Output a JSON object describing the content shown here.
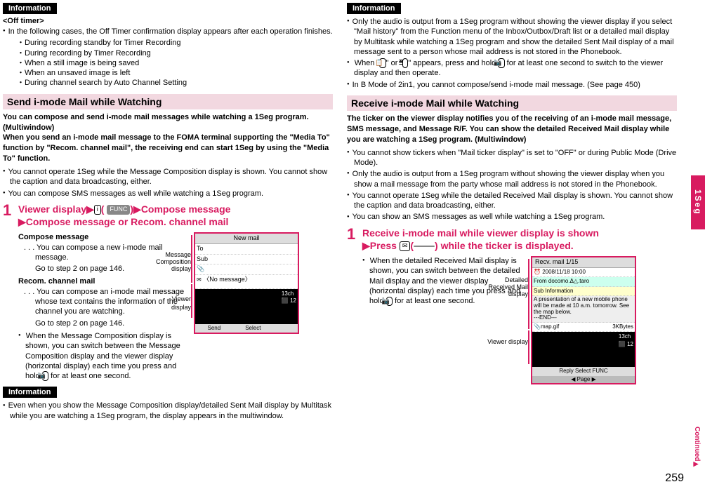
{
  "info_label": "Information",
  "col1": {
    "off_timer_hdr": "<Off timer>",
    "off_timer_intro": "In the following cases, the Off Timer confirmation display appears after each operation finishes.",
    "off_timer_items": [
      "・During recording standby for Timer Recording",
      "・During recording by Timer Recording",
      "・When a still image is being saved",
      "・When an unsaved image is left",
      "・During channel search by Auto Channel Setting"
    ],
    "section_send": "Send i-mode Mail while Watching",
    "send_bold": "You can compose and send i-mode mail messages while watching a 1Seg program. (Multiwindow)\nWhen you send an i-mode mail message to the FOMA terminal supporting the \"Media To\" function by \"Recom. channel mail\", the receiving end can start 1Seg by using the \"Media To\" function.",
    "send_b1": "You cannot operate 1Seg while the Message Composition display is shown. You cannot show the caption and data broadcasting, either.",
    "send_b2": "You can compose SMS messages as well while watching a 1Seg program.",
    "step1_num": "1",
    "step1a": "Viewer display",
    "step1_btn1": "i",
    "step1_func": "FUNC",
    "step1b": "Compose message",
    "step1c": "Compose message or Recom. channel mail",
    "compose_hdr": "Compose message",
    "compose_1": "You can compose a new i-mode mail message.",
    "compose_2": "Go to step 2 on page 146.",
    "recom_hdr": "Recom. channel mail",
    "recom_1": "You can compose an i-mode mail message whose text contains the information of the channel you are watching.",
    "recom_2": "Go to step 2 on page 146.",
    "compose_b3": "When the Message Composition display is shown, you can switch between the Message Composition display and the viewer display (horizontal display) each time you press and hold",
    "compose_b3_tail": "for at least one second.",
    "callout_msg": "Message Composition display",
    "callout_viewer": "Viewer display",
    "shot_title": "New mail",
    "shot_sub": "〈No message〉",
    "info2_text": "Even when you show the Message Composition display/detailed Sent Mail display by Multitask while you are watching a 1Seg program, the display appears in the multiwindow."
  },
  "col2": {
    "info1_b1": "Only the audio is output from a 1Seg program without showing the viewer display if you select \"Mail history\" from the Function menu of the Inbox/Outbox/Draft list or a detailed mail display by Multitask while watching a 1Seg program and show the detailed Sent Mail display of a mail message sent to a person whose mail address is not stored in the Phonebook.",
    "info1_b2a": "When \"",
    "info1_b2b": "\" or \"",
    "info1_b2c": "\" appears, press and hold",
    "info1_b2d": "for at least one second to switch to the viewer display and then operate.",
    "info1_b3": "In B Mode of 2in1, you cannot compose/send i-mode mail message. (See page 450)",
    "section_recv": "Receive i-mode Mail while Watching",
    "recv_bold": "The ticker on the viewer display notifies you of the receiving of an i-mode mail message, SMS message, and Message R/F. You can show the detailed Received Mail display while you are watching a 1Seg program. (Multiwindow)",
    "recv_b1": "You cannot show tickers when \"Mail ticker display\" is set to \"OFF\" or during Public Mode (Drive Mode).",
    "recv_b2": "Only the audio is output from a 1Seg program without showing the viewer display when you show a mail message from the party whose mail address is not stored in the Phonebook.",
    "recv_b3": "You cannot operate 1Seg while the detailed Received Mail display is shown. You cannot show the caption and data broadcasting, either.",
    "recv_b4": "You can show an SMS messages as well while watching a 1Seg program.",
    "step1_num": "1",
    "step1a": "Receive i-mode mail while viewer display is shown",
    "step1b": "Press",
    "step1c": "(",
    "step1d": ") while the ticker is displayed.",
    "recv_sub": "When the detailed Received Mail display is shown, you can switch between the detailed Mail display and the viewer display (horizontal display) each time you press and hold",
    "recv_sub_tail": "for at least one second.",
    "callout_detail": "Detailed Received Mail display",
    "callout_viewer": "Viewer display",
    "shot_hdr_recv": "Recv. mail     1/15",
    "shot_date": "2008/11/18 10:00",
    "shot_from": "From docomo.Δ△.taro",
    "shot_sub": "Sub Information",
    "shot_body1": "A presentation of a new mobile phone will be made at 10 a.m. tomorrow. See the map below.",
    "shot_body2": "---END---",
    "shot_attach": "map.gif",
    "shot_size": "3KBytes",
    "shot_btns": "Reply    Select    FUNC"
  },
  "side_tab": "1Seg",
  "page_num": "259",
  "continued": "Continued"
}
